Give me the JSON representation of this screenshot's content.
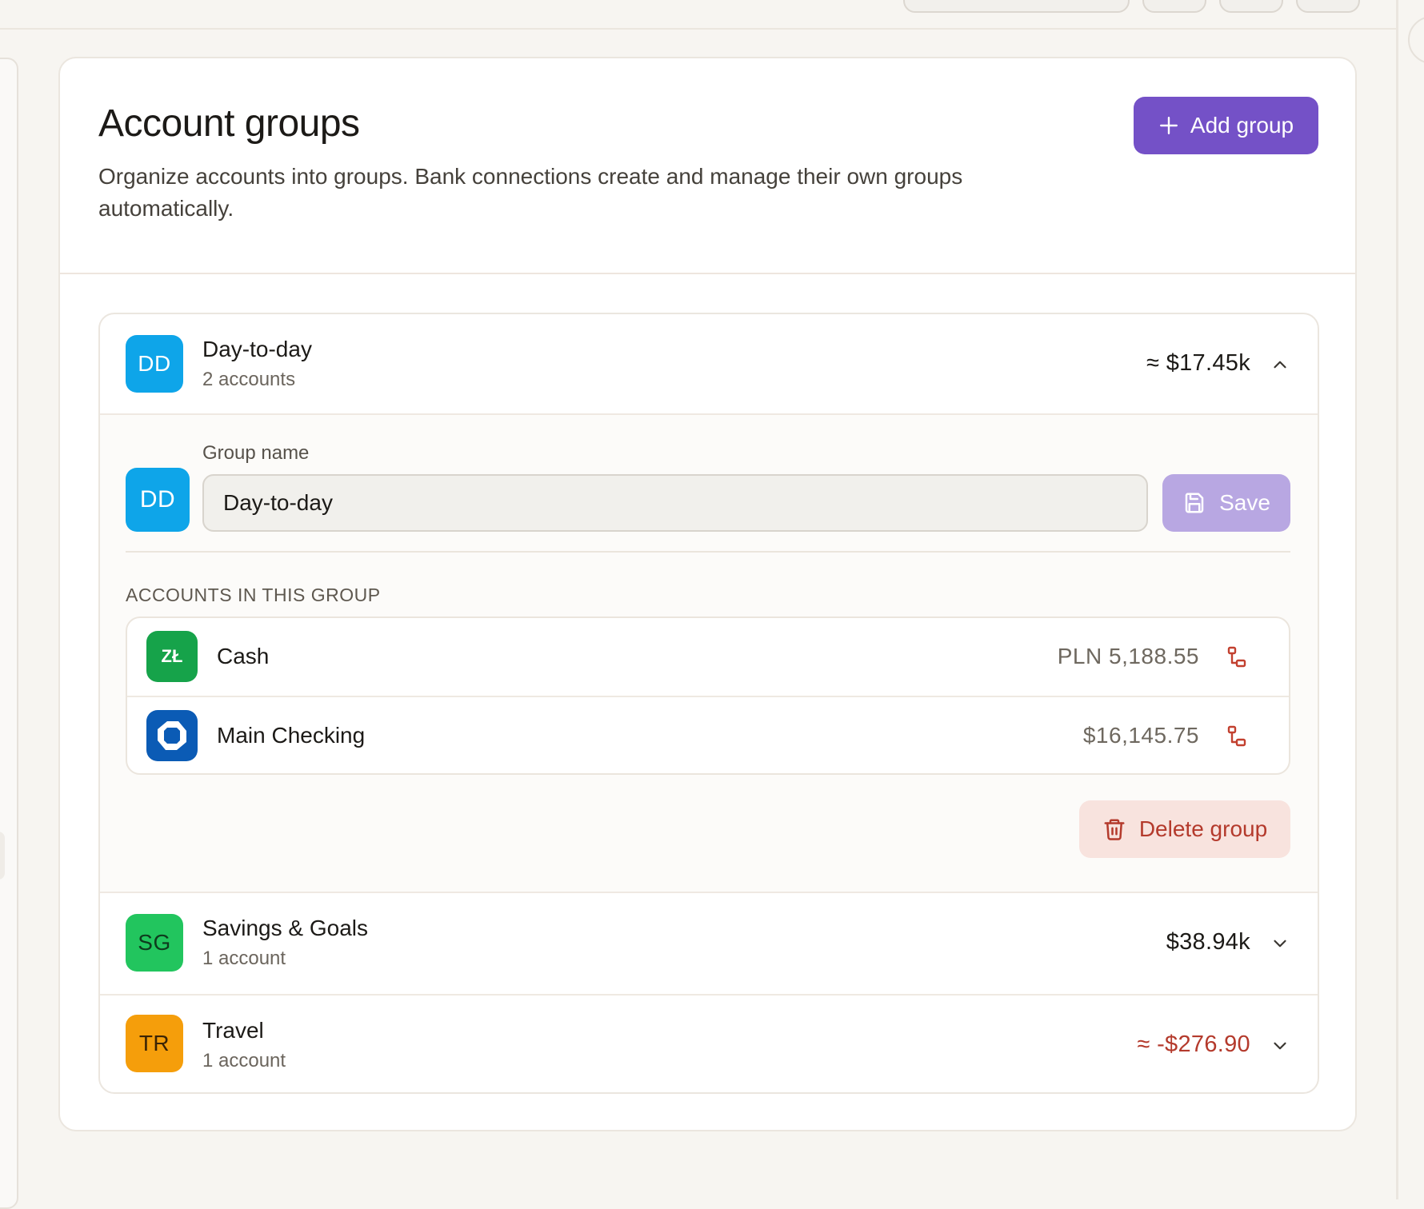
{
  "header": {
    "title": "Account groups",
    "description": "Organize accounts into groups. Bank connections create and manage their own groups automatically.",
    "add_button_label": "Add group"
  },
  "groups": [
    {
      "initials": "DD",
      "name": "Day-to-day",
      "count": "2 accounts",
      "total": "≈ $17.45k",
      "color": "#0ea5e9",
      "expanded": true
    },
    {
      "initials": "SG",
      "name": "Savings & Goals",
      "count": "1 account",
      "total": "$38.94k",
      "color": "#22c55e",
      "expanded": false
    },
    {
      "initials": "TR",
      "name": "Travel",
      "count": "1 account",
      "total": "≈ -$276.90",
      "color": "#f59e0b",
      "expanded": false
    }
  ],
  "editor": {
    "field_label": "Group name",
    "group_name_value": "Day-to-day",
    "save_label": "Save",
    "section_label": "ACCOUNTS IN THIS GROUP",
    "accounts": [
      {
        "logo_text": "ZŁ",
        "name": "Cash",
        "balance": "PLN 5,188.55",
        "logo_color": "#16a34a"
      },
      {
        "logo_text": "",
        "name": "Main Checking",
        "balance": "$16,145.75",
        "logo_color": "#0b5bb5"
      }
    ],
    "delete_label": "Delete group"
  },
  "colors": {
    "accent": "#7451c7",
    "save_disabled": "#b8a7e2",
    "danger": "#b43a2c",
    "danger_bg": "#f8e3de"
  },
  "icons": {
    "add": "plus-icon",
    "collapse": "chevron-up-icon",
    "expand": "chevron-down-icon",
    "save": "floppy-disk-icon",
    "remove_account": "unlink-icon",
    "delete": "trash-icon",
    "bank": "chase-octagon-icon"
  }
}
